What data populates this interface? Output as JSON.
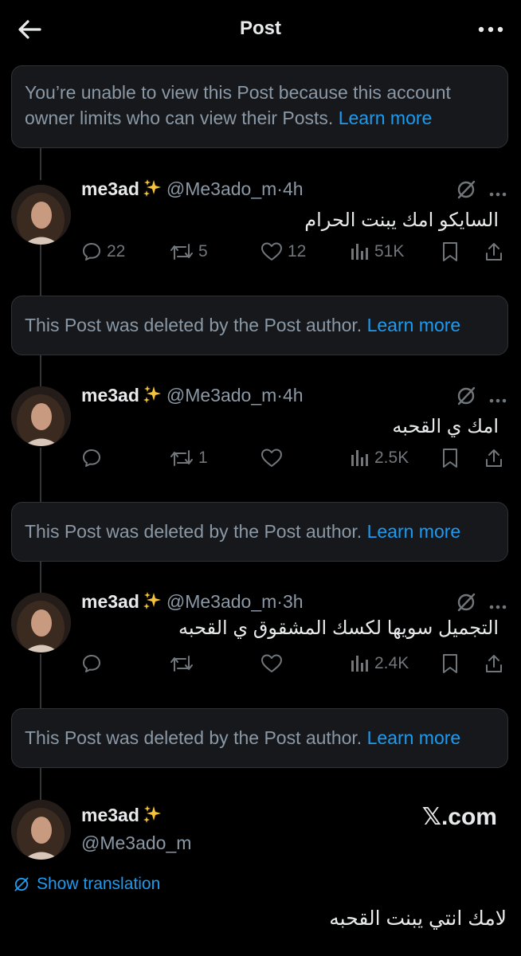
{
  "header": {
    "title": "Post"
  },
  "restricted_notice": {
    "text": "You’re unable to view this Post because this account owner limits who can view their Posts.",
    "link": "Learn more"
  },
  "deleted_notice": {
    "text": "This Post was deleted by the Post author.",
    "link": "Learn more"
  },
  "tweets": [
    {
      "name": "me3ad",
      "handle": "@Me3ado_m",
      "time": "4h",
      "text": "السايكو امك يبنت الحرام",
      "replies": "22",
      "reposts": "5",
      "likes": "12",
      "views": "51K"
    },
    {
      "name": "me3ad",
      "handle": "@Me3ado_m",
      "time": "4h",
      "text": "امك ي القحبه",
      "replies": "",
      "reposts": "1",
      "likes": "",
      "views": "2.5K"
    },
    {
      "name": "me3ad",
      "handle": "@Me3ado_m",
      "time": "3h",
      "text": "التجميل سويها لكسك المشقوق ي القحبه",
      "replies": "",
      "reposts": "",
      "likes": "",
      "views": "2.4K"
    }
  ],
  "final_post": {
    "name": "me3ad",
    "handle": "@Me3ado_m",
    "source": "𝕏.com",
    "show_translation": "Show translation",
    "text": "لامك انتي يبنت القحبه"
  },
  "separator": "·",
  "colors": {
    "background": "#000000",
    "card": "#16181c",
    "link": "#1d9bf0",
    "muted": "#71767b",
    "text": "#e7e9ea"
  },
  "icons": [
    "back-arrow-icon",
    "more-icon",
    "sparkles-icon",
    "grok-icon",
    "caret-icon",
    "reply-icon",
    "repost-icon",
    "like-icon",
    "views-icon",
    "bookmark-icon",
    "share-icon",
    "translate-icon"
  ]
}
